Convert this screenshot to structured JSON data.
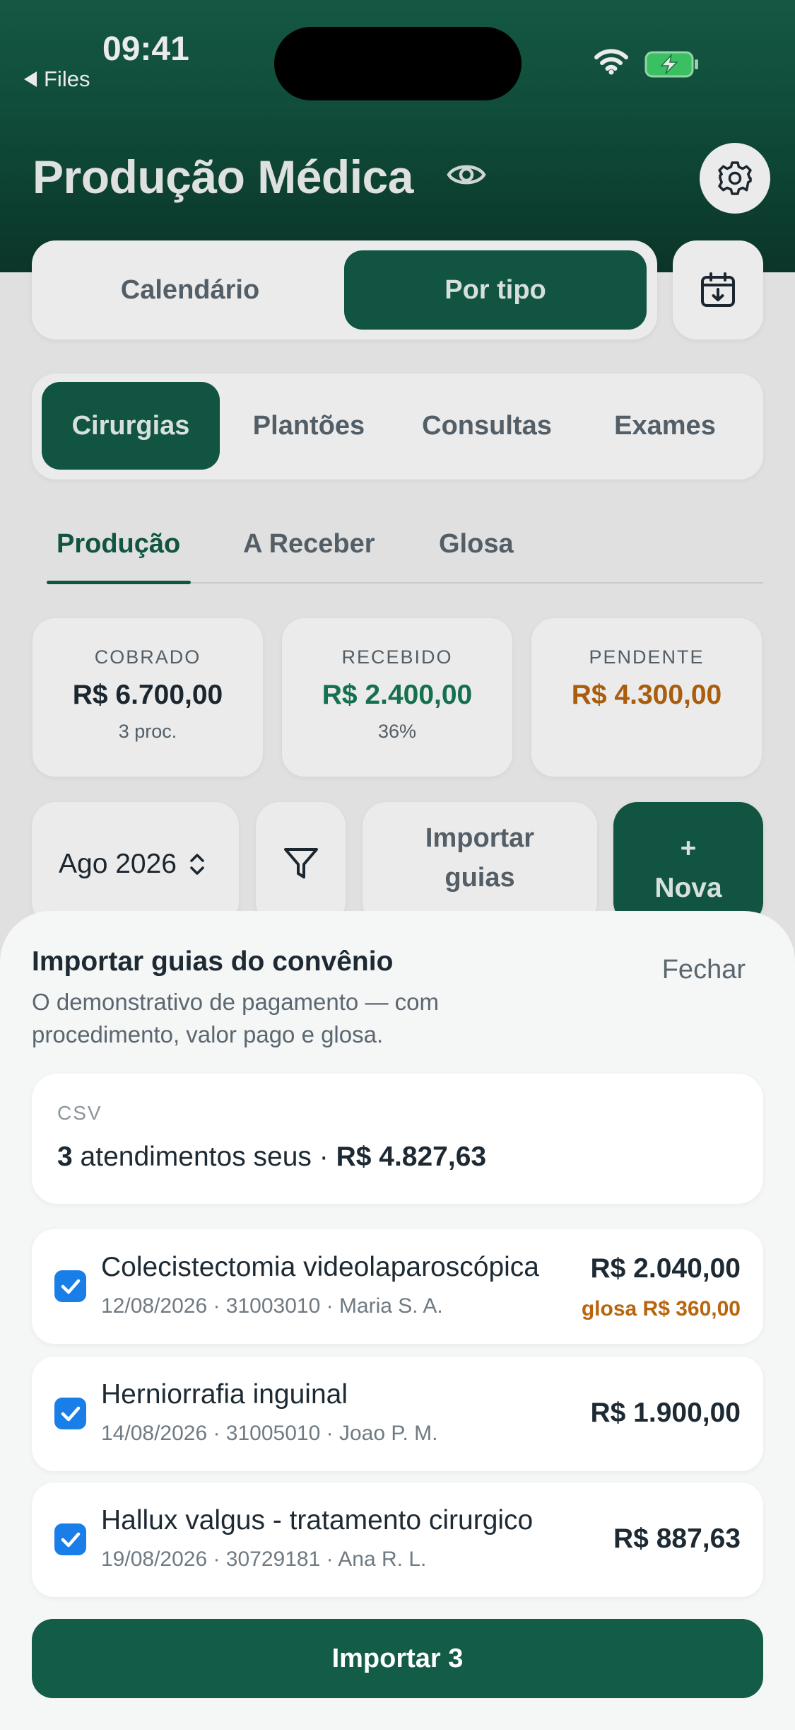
{
  "status_bar": {
    "time": "09:41",
    "back_label": "Files"
  },
  "header": {
    "title": "Produção Médica"
  },
  "view_toggle": {
    "items": [
      "Calendário",
      "Por tipo"
    ],
    "selected": "Por tipo"
  },
  "categories": {
    "items": [
      "Cirurgias",
      "Plantões",
      "Consultas",
      "Exames"
    ],
    "selected": "Cirurgias"
  },
  "subtabs": {
    "items": [
      "Produção",
      "A Receber",
      "Glosa"
    ],
    "selected": "Produção"
  },
  "stats": [
    {
      "label": "COBRADO",
      "value": "R$ 6.700,00",
      "sub": "3 proc.",
      "color": "#1e2a33"
    },
    {
      "label": "RECEBIDO",
      "value": "R$ 2.400,00",
      "sub": "36%",
      "color": "#167a55"
    },
    {
      "label": "PENDENTE",
      "value": "R$ 4.300,00",
      "sub": "",
      "color": "#b9650f"
    }
  ],
  "controls": {
    "month": "Ago 2026",
    "import_label_line1": "Importar",
    "import_label_line2": "guias",
    "new_plus": "+",
    "new_label": "Nova"
  },
  "sheet": {
    "title": "Importar guias do convênio",
    "subtitle": "O demonstrativo de pagamento — com procedimento, valor pago e glosa.",
    "close_label": "Fechar",
    "summary": {
      "format": "CSV",
      "count": "3",
      "count_text": " atendimentos seus · ",
      "total": "R$ 4.827,63"
    },
    "items": [
      {
        "title": "Colecistectomia videolaparoscópica",
        "meta": "12/08/2026 · 31003010 · Maria S. A.",
        "amount": "R$ 2.040,00",
        "glosa": "glosa R$ 360,00",
        "checked": true
      },
      {
        "title": "Herniorrafia inguinal",
        "meta": "14/08/2026 · 31005010 · Joao P. M.",
        "amount": "R$ 1.900,00",
        "glosa": "",
        "checked": true
      },
      {
        "title": "Hallux valgus - tratamento cirurgico",
        "meta": "19/08/2026 · 30729181 · Ana R. L.",
        "amount": "R$ 887,63",
        "glosa": "",
        "checked": true
      }
    ],
    "import_button": "Importar 3"
  },
  "colors": {
    "brand": "#135c48",
    "header": "#16604a",
    "pending": "#b9650f",
    "received": "#167a55",
    "checkbox": "#1a7ee8"
  },
  "icons": [
    "wifi-icon",
    "battery-charging-icon",
    "eye-icon",
    "gear-icon",
    "calendar-download-icon",
    "chevron-updown-icon",
    "filter-icon",
    "checkmark-icon"
  ]
}
